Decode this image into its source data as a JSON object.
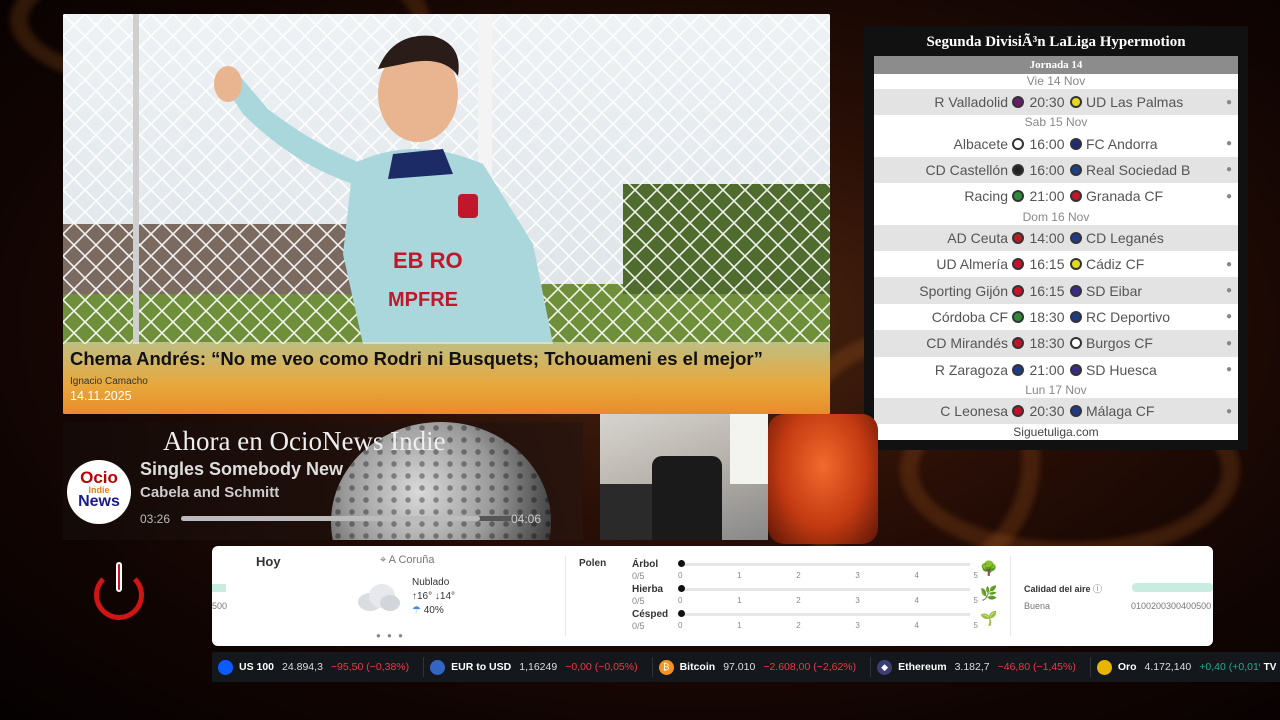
{
  "news": {
    "headline": "Chema Andrés: “No me veo como Rodri ni Busquets; Tchouameni es el mejor”",
    "author": "Ignacio Camacho",
    "date": "14.11.2025",
    "shirt_text_1": "EB RO",
    "shirt_text_2": "MPFRE"
  },
  "league": {
    "title": "Segunda DivisiÃ³n LaLiga Hypermotion",
    "round": "Jornada 14",
    "footer": "Siguetuliga.com",
    "days": [
      {
        "label": "Vie 14 Nov",
        "matches": [
          {
            "home": "R Valladolid",
            "time": "20:30",
            "away": "UD Las Palmas",
            "home_color": "#6a1b6b",
            "away_color": "#e6d81c",
            "pin": true
          }
        ]
      },
      {
        "label": "Sab 15 Nov",
        "matches": [
          {
            "home": "Albacete",
            "time": "16:00",
            "away": "FC Andorra",
            "home_color": "#ffffff",
            "away_color": "#1f2a7a",
            "pin": true
          },
          {
            "home": "CD Castellón",
            "time": "16:00",
            "away": "Real Sociedad B",
            "home_color": "#222222",
            "away_color": "#1e3f8a",
            "pin": true
          },
          {
            "home": "Racing",
            "time": "21:00",
            "away": "Granada CF",
            "home_color": "#2e8b3a",
            "away_color": "#c0182a",
            "pin": true
          }
        ]
      },
      {
        "label": "Dom 16 Nov",
        "matches": [
          {
            "home": "AD Ceuta",
            "time": "14:00",
            "away": "CD Leganés",
            "home_color": "#b41f22",
            "away_color": "#1e3a8a",
            "pin": false
          },
          {
            "home": "UD Almería",
            "time": "16:15",
            "away": "Cádiz CF",
            "home_color": "#c8102e",
            "away_color": "#e6d81c",
            "pin": true
          },
          {
            "home": "Sporting Gijón",
            "time": "16:15",
            "away": "SD Eibar",
            "home_color": "#d0102a",
            "away_color": "#3a2a8a",
            "pin": true
          },
          {
            "home": "Córdoba CF",
            "time": "18:30",
            "away": "RC Deportivo",
            "home_color": "#2e8b3a",
            "away_color": "#1e3a8a",
            "pin": true
          },
          {
            "home": "CD Mirandés",
            "time": "18:30",
            "away": "Burgos CF",
            "home_color": "#c0102a",
            "away_color": "#ffffff",
            "pin": true
          },
          {
            "home": "R Zaragoza",
            "time": "21:00",
            "away": "SD Huesca",
            "home_color": "#1e3a8a",
            "away_color": "#3a2a8a",
            "pin": true
          }
        ]
      },
      {
        "label": "Lun 17 Nov",
        "matches": [
          {
            "home": "C Leonesa",
            "time": "20:30",
            "away": "Málaga CF",
            "home_color": "#c0102a",
            "away_color": "#1e3a8a",
            "pin": true
          }
        ]
      }
    ]
  },
  "radio": {
    "heading": "Ahora en OcioNews Indie",
    "logo_line1": "Ocio",
    "logo_line2": "Indie",
    "logo_line3": "News",
    "track": "Singles Somebody New",
    "artist": "Cabela and Schmitt",
    "elapsed": "03:26",
    "duration": "04:06",
    "progress": 0.84
  },
  "weather": {
    "today_label": "Hoy",
    "location": "A Coruña",
    "condition": "Nublado",
    "temps": "↑16° ↓14°",
    "rain": "40%",
    "pager": "● ● ●",
    "left_cut_value": "500",
    "pollen_label": "Polen",
    "pollen": [
      {
        "name": "Árbol",
        "score": "0/5",
        "value": 0,
        "icon": "tree-icon",
        "glyph": "🌳"
      },
      {
        "name": "Hierba",
        "score": "0/5",
        "value": 0,
        "icon": "weed-icon",
        "glyph": "🌿"
      },
      {
        "name": "Césped",
        "score": "0/5",
        "value": 0,
        "icon": "grass-icon",
        "glyph": "🌱"
      }
    ],
    "scale_ticks": [
      "0",
      "1",
      "2",
      "3",
      "4",
      "5"
    ],
    "air_label": "Calidad del aire",
    "air_status": "Buena",
    "air_scale": "0100200300400500"
  },
  "ticker": [
    {
      "name": "US 100",
      "price": "24.894,3",
      "change": "−95,50 (−0,38%)",
      "dir": "neg",
      "icon": "us100-icon",
      "color": "#0b5cff",
      "glyph": ""
    },
    {
      "name": "EUR to USD",
      "price": "1,16249",
      "change": "−0,00 (−0,05%)",
      "dir": "neg",
      "icon": "eurusd-icon",
      "color": "#3465c3",
      "glyph": ""
    },
    {
      "name": "Bitcoin",
      "price": "97.010",
      "change": "−2.608,00 (−2,62%)",
      "dir": "neg",
      "icon": "bitcoin-icon",
      "color": "#f7931a",
      "glyph": "₿"
    },
    {
      "name": "Ethereum",
      "price": "3.182,7",
      "change": "−46,80 (−1,45%)",
      "dir": "neg",
      "icon": "ethereum-icon",
      "color": "#3b3f73",
      "glyph": "◆"
    },
    {
      "name": "Oro",
      "price": "4.172,140",
      "change": "+0,40 (+0,01%)",
      "dir": "pos",
      "icon": "gold-icon",
      "color": "#e8b500",
      "glyph": ""
    }
  ],
  "ticker_logo": "TV"
}
